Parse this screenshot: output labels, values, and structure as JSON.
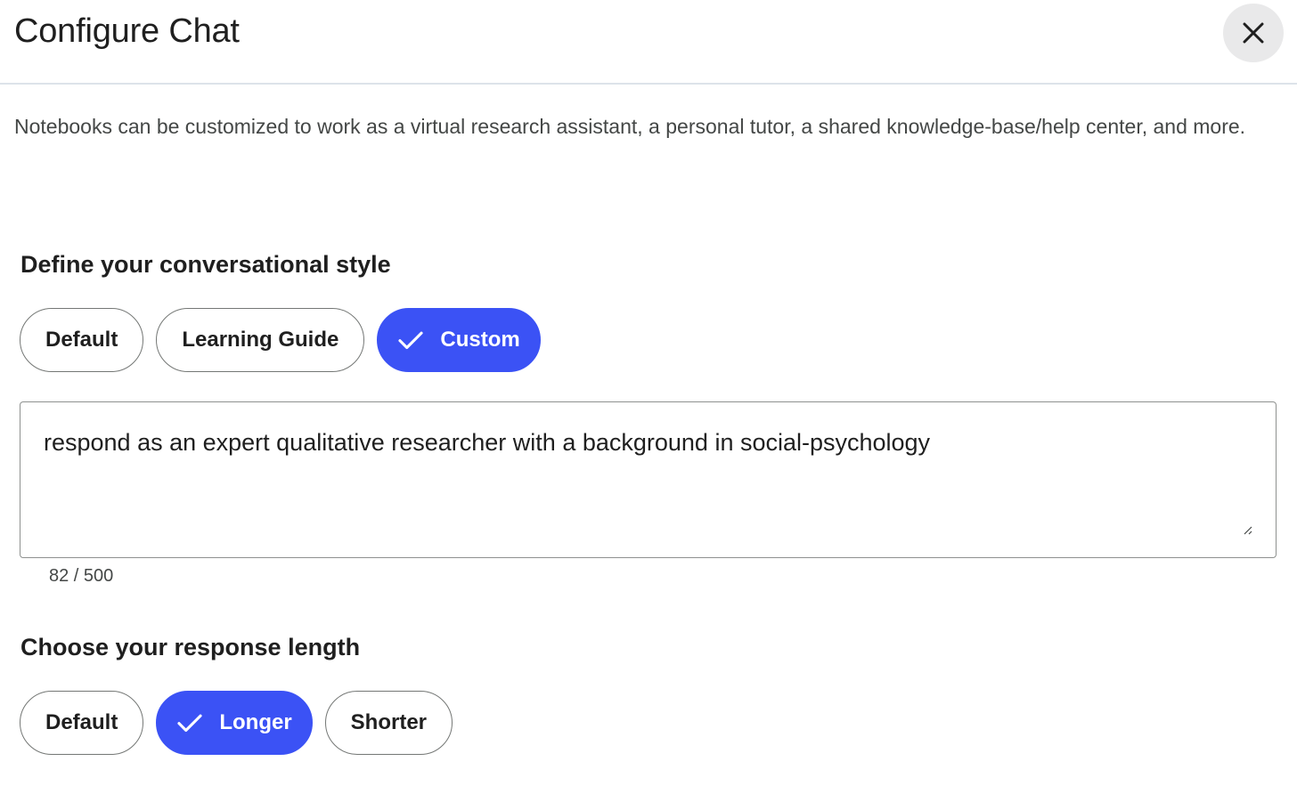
{
  "header": {
    "title": "Configure Chat",
    "close_icon": "close-icon"
  },
  "description": "Notebooks can be customized to work as a virtual research assistant, a personal tutor, a shared knowledge-base/help center, and more.",
  "style_section": {
    "heading": "Define your conversational style",
    "options": [
      {
        "label": "Default",
        "selected": false
      },
      {
        "label": "Learning Guide",
        "selected": false
      },
      {
        "label": "Custom",
        "selected": true,
        "icon": "check-icon"
      }
    ],
    "custom_prompt": {
      "value": "respond as an expert qualitative researcher with a background in social-psychology",
      "char_count": "82 / 500"
    }
  },
  "length_section": {
    "heading": "Choose your response length",
    "options": [
      {
        "label": "Default",
        "selected": false
      },
      {
        "label": "Longer",
        "selected": true,
        "icon": "check-icon"
      },
      {
        "label": "Shorter",
        "selected": false
      }
    ]
  },
  "colors": {
    "accent": "#3b52f5",
    "close_button_bg": "#e9e9ea",
    "border": "#747775"
  }
}
